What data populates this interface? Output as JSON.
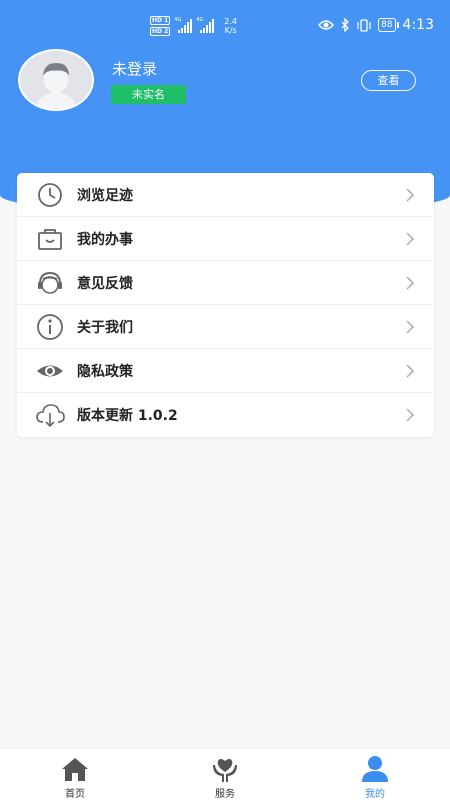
{
  "status_bar": {
    "hd1": "HD 1",
    "hd2": "HD 2",
    "signal1_label": "4G",
    "signal2_label": "4G",
    "speed_value": "2.4",
    "speed_unit": "K/s",
    "battery": "88",
    "time": "4:13"
  },
  "profile": {
    "username": "未登录",
    "verify_badge": "未实名",
    "view_button": "查看"
  },
  "menu": {
    "items": [
      {
        "label": "浏览足迹",
        "icon": "clock-icon"
      },
      {
        "label": "我的办事",
        "icon": "bag-icon"
      },
      {
        "label": "意见反馈",
        "icon": "headset-icon"
      },
      {
        "label": "关于我们",
        "icon": "info-icon"
      },
      {
        "label": "隐私政策",
        "icon": "eye-icon"
      },
      {
        "label": "版本更新 1.0.2",
        "icon": "cloud-download-icon"
      }
    ]
  },
  "bottom_nav": {
    "items": [
      {
        "label": "首页",
        "icon": "home-icon"
      },
      {
        "label": "服务",
        "icon": "heart-hands-icon"
      },
      {
        "label": "我的",
        "icon": "user-icon",
        "active": true
      }
    ]
  },
  "colors": {
    "header": "#4593f5",
    "badge": "#1fbf6a",
    "active_tab": "#3c8df0"
  }
}
